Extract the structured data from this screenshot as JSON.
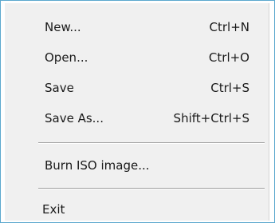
{
  "menu": {
    "items": [
      {
        "label": "New...",
        "shortcut": "Ctrl+N"
      },
      {
        "label": "Open...",
        "shortcut": "Ctrl+O"
      },
      {
        "label": "Save",
        "shortcut": "Ctrl+S"
      },
      {
        "label": "Save As...",
        "shortcut": "Shift+Ctrl+S"
      },
      {
        "label": "Burn ISO image..."
      },
      {
        "label": "Exit"
      }
    ]
  }
}
